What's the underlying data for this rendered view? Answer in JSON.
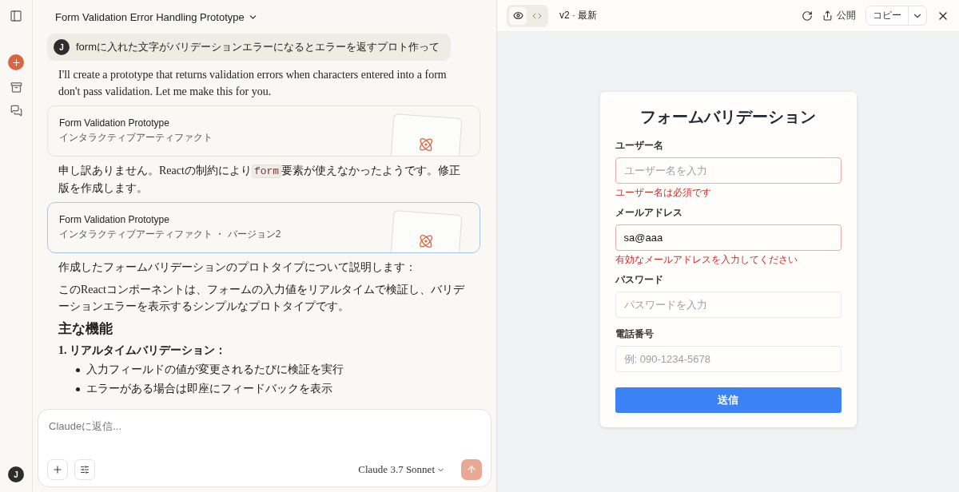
{
  "sidebar": {
    "user_initial": "J"
  },
  "chat": {
    "title": "Form Validation Error Handling Prototype",
    "user_message": {
      "initial": "J",
      "text": "formに入れた文字がバリデーションエラーになるとエラーを返すプロト作って"
    },
    "blocks": [
      {
        "kind": "paragraph",
        "text": "I'll create a prototype that returns validation errors when characters entered into a form don't pass validation. Let me make this for you."
      },
      {
        "kind": "artifact",
        "title": "Form Validation Prototype",
        "subtitle": "インタラクティブアーティファクト",
        "selected": false
      },
      {
        "kind": "segments",
        "parts": [
          {
            "kind": "text",
            "text": "申し訳ありません。Reactの制約により"
          },
          {
            "kind": "code",
            "text": "form"
          },
          {
            "kind": "text",
            "text": "要素が使えなかったようです。修正版を作成します。"
          }
        ]
      },
      {
        "kind": "artifact",
        "title": "Form Validation Prototype",
        "subtitle": "インタラクティブアーティファクト ・ バージョン2",
        "selected": true
      },
      {
        "kind": "paragraph",
        "text": "作成したフォームバリデーションのプロトタイプについて説明します："
      },
      {
        "kind": "paragraph",
        "text": "このReactコンポーネントは、フォームの入力値をリアルタイムで検証し、バリデーションエラーを表示するシンプルなプロトタイプです。"
      },
      {
        "kind": "heading",
        "text": "主な機能"
      },
      {
        "kind": "numbered",
        "number": "1.",
        "text": "リアルタイムバリデーション：",
        "bullets": [
          "入力フィールドの値が変更されるたびに検証を実行",
          "エラーがある場合は即座にフィードバックを表示"
        ]
      }
    ],
    "composer": {
      "placeholder": "Claudeに返信...",
      "model": "Claude 3.7 Sonnet"
    }
  },
  "preview": {
    "modes": [
      {
        "kind": "preview",
        "selected": true
      },
      {
        "kind": "code",
        "selected": false
      }
    ],
    "version": "v2 · 最新",
    "publish": "公開",
    "copy": "コピー",
    "form": {
      "title": "フォームバリデーション",
      "fields": [
        {
          "label": "ユーザー名",
          "placeholder": "ユーザー名を入力",
          "error": "ユーザー名は必須です"
        },
        {
          "label": "メールアドレス",
          "value": "sa@aaa",
          "error": "有効なメールアドレスを入力してください"
        },
        {
          "label": "パスワード",
          "placeholder": "パスワードを入力"
        },
        {
          "label": "電話番号",
          "placeholder": "例: 090-1234-5678"
        }
      ],
      "submit": "送信"
    }
  }
}
